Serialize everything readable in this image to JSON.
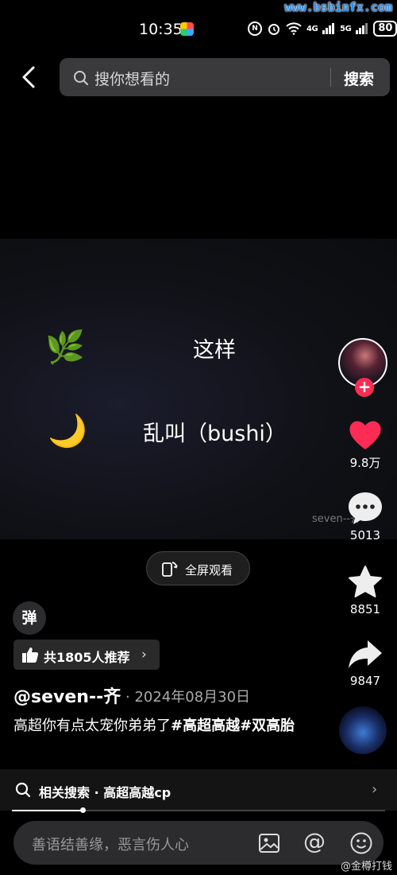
{
  "status_bar": {
    "time": "10:35",
    "net1": "4G",
    "net2": "5G",
    "battery": "80"
  },
  "watermark_top": "www.bsbinfx.com",
  "search": {
    "placeholder": "搜你想看的",
    "button": "搜索"
  },
  "video": {
    "line1": "这样",
    "line2": "乱叫（bushi）",
    "emoji1": "🌿",
    "emoji2": "🌙",
    "watermark": "seven--齐"
  },
  "rail": {
    "likes": "9.8万",
    "comments": "5013",
    "favorites": "8851",
    "shares": "9847",
    "follow": "+"
  },
  "fullscreen_label": "全屏观看",
  "danmaku_label": "弹",
  "recommend": {
    "label": "共1805人推荐",
    "chevron": "›"
  },
  "author": "@seven--齐",
  "date": "· 2024年08月30日",
  "caption": {
    "text": "高超你有点太宠你弟弟了",
    "tag1": "#高超高越",
    "tag2": "#双高胎"
  },
  "related": {
    "label": "相关搜索 · 高超高越cp",
    "chevron": "›"
  },
  "progress_fraction": 0.19,
  "comment": {
    "placeholder": "善语结善缘，恶言伤人心",
    "at": "@"
  },
  "watermark_bottom": "@金樽打钱",
  "colors": {
    "like": "#fe2c55",
    "follow": "#fe2c55",
    "watermark_top": "#2a8cf0"
  }
}
